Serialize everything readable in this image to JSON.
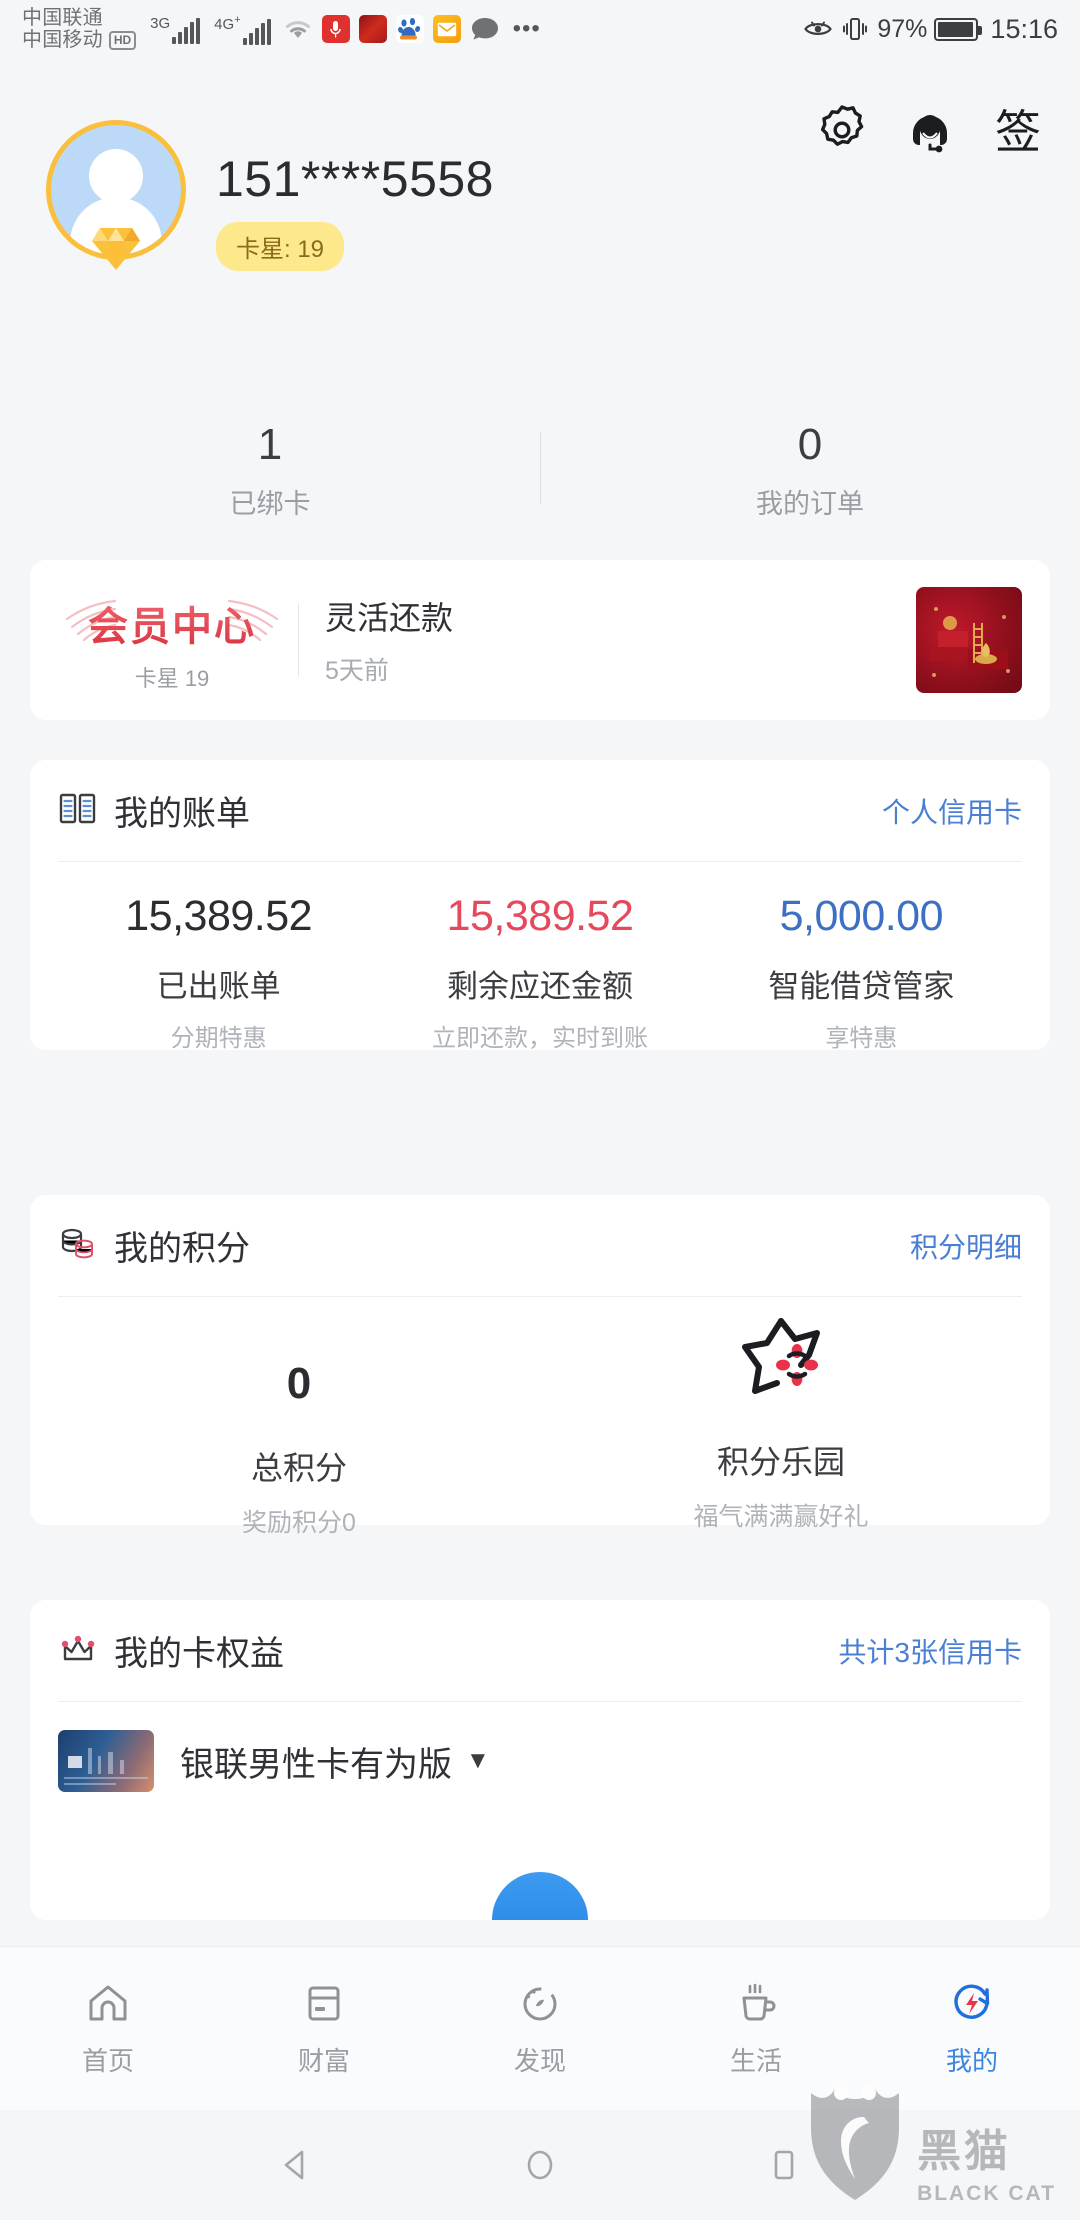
{
  "statusbar": {
    "carrier1": "中国联通",
    "carrier2": "中国移动",
    "hd": "HD",
    "net1": "3G",
    "net2": "4G",
    "net2_sup": "+",
    "battery_pct": "97%",
    "clock": "15:16",
    "icons": [
      "wifi-icon",
      "mic-icon",
      "app-red-icon",
      "baidu-icon",
      "mail-icon",
      "chat-icon",
      "more-dots-icon"
    ],
    "right_icons": [
      "eye-icon",
      "vibrate-icon"
    ]
  },
  "header": {
    "actions": [
      {
        "name": "settings-gear",
        "label": ""
      },
      {
        "name": "customer-service",
        "label": ""
      },
      {
        "name": "sign-in",
        "label": "签"
      }
    ]
  },
  "profile": {
    "phone": "151****5558",
    "star_badge": "卡星: 19"
  },
  "stats": [
    {
      "num": "1",
      "label": "已绑卡"
    },
    {
      "num": "0",
      "label": "我的订单"
    }
  ],
  "member_card": {
    "logo_text": "会员中心",
    "star_text": "卡星 19",
    "title": "灵活还款",
    "subtitle": "5天前"
  },
  "bill": {
    "title": "我的账单",
    "link": "个人信用卡",
    "items": [
      {
        "value": "15,389.52",
        "label": "已出账单",
        "sub": "分期特惠",
        "color": "#2b2d31"
      },
      {
        "value": "15,389.52",
        "label": "剩余应还金额",
        "sub": "立即还款，实时到账",
        "color": "#e6485c"
      },
      {
        "value": "5,000.00",
        "label": "智能借贷管家",
        "sub": "享特惠",
        "color": "#3d6fc4"
      }
    ]
  },
  "points": {
    "title": "我的积分",
    "link": "积分明细",
    "total_num": "0",
    "total_label": "总积分",
    "total_sub": "奖励积分0",
    "park_label": "积分乐园",
    "park_sub": "福气满满赢好礼"
  },
  "benefits": {
    "title": "我的卡权益",
    "link": "共计3张信用卡",
    "card_name": "银联男性卡有为版",
    "caret": "▼"
  },
  "bottom_nav": [
    {
      "label": "首页",
      "icon": "home-icon",
      "active": false
    },
    {
      "label": "财富",
      "icon": "card-icon",
      "active": false
    },
    {
      "label": "发现",
      "icon": "discover-icon",
      "active": false
    },
    {
      "label": "生活",
      "icon": "cup-icon",
      "active": false
    },
    {
      "label": "我的",
      "icon": "profile-icon",
      "active": true
    }
  ],
  "system_nav": [
    "back-triangle-icon",
    "home-circle-icon",
    "recents-square-icon"
  ],
  "watermark": {
    "cn": "黑猫",
    "en": "BLACK CAT"
  },
  "colors": {
    "accent_blue": "#4a7fd4",
    "red": "#e6485c",
    "gold": "#fbbf3e",
    "bg": "#f5f6f8"
  }
}
